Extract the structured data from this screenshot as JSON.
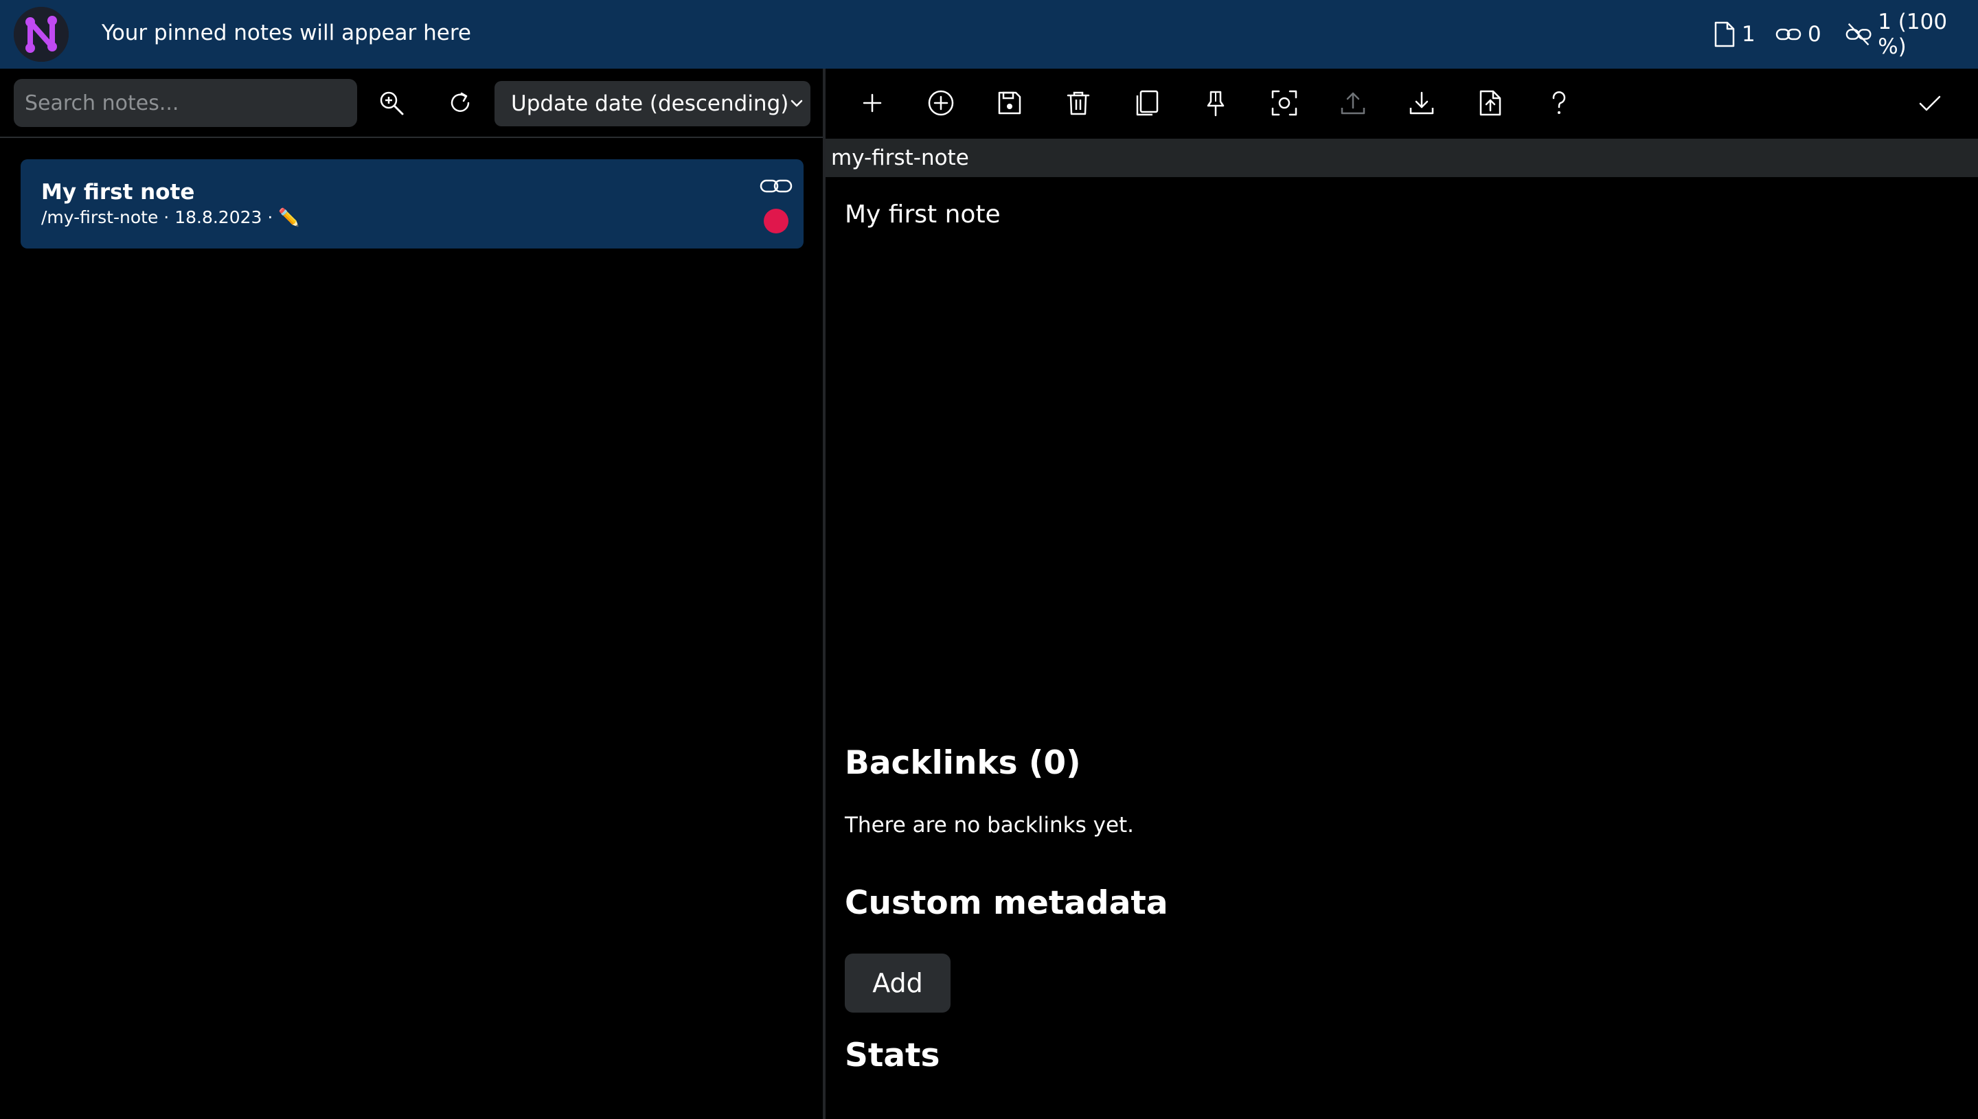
{
  "header": {
    "pinned_text": "Your pinned notes will appear here",
    "stats": {
      "notes_count": "1",
      "links_count": "0",
      "unlinked": "1 (100 %)"
    }
  },
  "search": {
    "placeholder": "Search notes..."
  },
  "sort": {
    "selected": "Update date (descending)"
  },
  "note_list": [
    {
      "title": "My first note",
      "meta": "/my-first-note · 18.8.2023 · ✏️",
      "dot_color": "#e0174c"
    }
  ],
  "editor": {
    "slug": "my-first-note",
    "content": "My first note"
  },
  "backlinks": {
    "heading": "Backlinks (0)",
    "empty_text": "There are no backlinks yet."
  },
  "custom_metadata": {
    "heading": "Custom metadata",
    "add_label": "Add"
  },
  "stats_section": {
    "heading": "Stats"
  },
  "colors": {
    "header_bg": "#0c3157",
    "note_selected_bg": "#0c3157",
    "input_bg": "#2a2d30",
    "accent_dot": "#e0174c",
    "logo_purple": "#c04af2"
  },
  "icons": {
    "toolbar": [
      "plus-icon",
      "plus-circle-icon",
      "save-icon",
      "trash-icon",
      "duplicate-icon",
      "pin-icon",
      "focus-icon",
      "upload-icon",
      "download-icon",
      "import-file-icon",
      "help-icon",
      "check-icon"
    ]
  }
}
